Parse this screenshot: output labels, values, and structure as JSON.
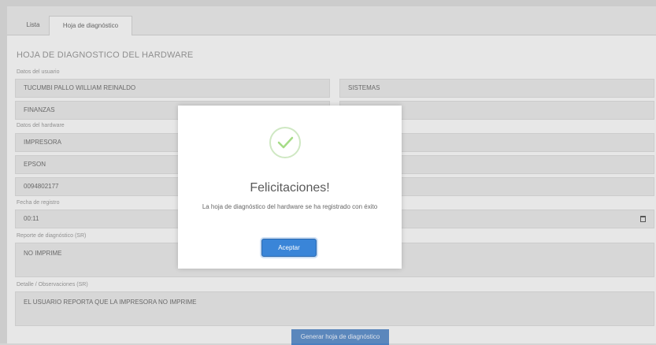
{
  "tabs": [
    "Lista",
    "Hoja de diagnóstico"
  ],
  "form": {
    "title": "HOJA DE DIAGNOSTICO DEL HARDWARE",
    "user_label": "Datos del usuario",
    "user_name": "TUCUMBI PALLO WILLIAM REINALDO",
    "user_role": "SISTEMAS",
    "user_area": "FINANZAS",
    "hardware_label": "Datos del hardware",
    "hw_type": "IMPRESORA",
    "hw_brand": "EPSON",
    "hw_code": "0094802177",
    "date_label": "Fecha de registro",
    "date_value": "00:11",
    "diagnosis_label": "Reporte de diagnóstico (SR)",
    "diagnosis_value": "NO IMPRIME",
    "observations_label": "Detalle / Observaciones (SR)",
    "observations_value": "EL USUARIO REPORTA QUE LA IMPRESORA NO IMPRIME",
    "submit_label": "Generar hoja de diagnóstico"
  },
  "modal": {
    "title": "Felicitaciones!",
    "message": "La hoja de diagnóstico del hardware se ha registrado con éxito",
    "button": "Aceptar",
    "success_color": "#a5dc86",
    "button_color": "#3a85d8"
  }
}
